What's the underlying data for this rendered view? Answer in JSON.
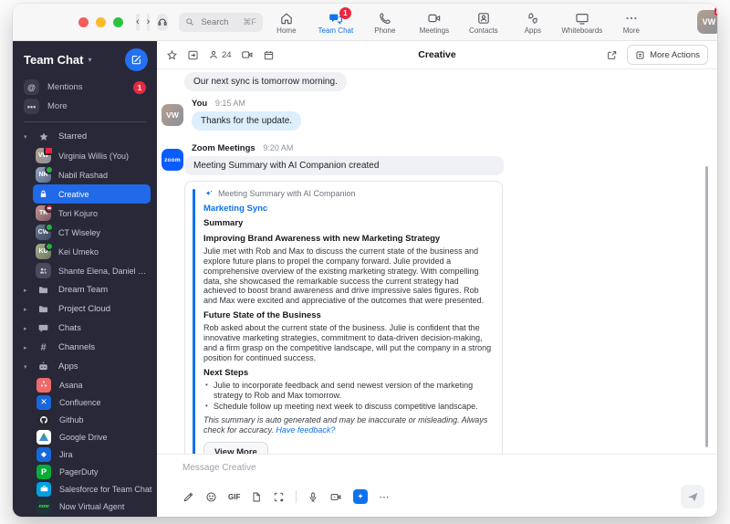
{
  "colors": {
    "accent_blue": "#0E72ED",
    "selection_blue": "#2069E8",
    "badge_red": "#E8283F",
    "presence_green": "#23B33A",
    "sidebar_bg": "#282839"
  },
  "titlebar": {
    "search": {
      "placeholder": "Search",
      "shortcut": "⌘F"
    },
    "nav": [
      {
        "label": "Home",
        "icon": "home-icon"
      },
      {
        "label": "Team Chat",
        "icon": "team-chat-icon",
        "badge": "1",
        "active": true
      },
      {
        "label": "Phone",
        "icon": "phone-icon"
      },
      {
        "label": "Meetings",
        "icon": "meetings-icon"
      },
      {
        "label": "Contacts",
        "icon": "contacts-icon"
      },
      {
        "label": "Apps",
        "icon": "apps-icon"
      },
      {
        "label": "Whiteboards",
        "icon": "whiteboards-icon"
      },
      {
        "label": "More",
        "icon": "ellipsis-icon"
      }
    ],
    "user": {
      "initials": "VW",
      "status": "recording"
    }
  },
  "sidebar": {
    "title": "Team Chat",
    "mentions": {
      "label": "Mentions",
      "badge": "1",
      "icon": "at-icon"
    },
    "more": {
      "label": "More",
      "icon": "ellipsis-icon"
    },
    "starred": {
      "label": "Starred",
      "items": [
        {
          "name": "Virginia Willis (You)",
          "initials": "VW",
          "status": "recording"
        },
        {
          "name": "Nabil Rashad",
          "initials": "NR",
          "status": "online"
        },
        {
          "name": "Creative",
          "type": "locked-channel",
          "selected": true
        },
        {
          "name": "Tori Kojuro",
          "initials": "TK",
          "status": "dnd"
        },
        {
          "name": "CT Wiseley",
          "initials": "CW",
          "status": "online"
        },
        {
          "name": "Kei Umeko",
          "initials": "KU",
          "status": "online"
        },
        {
          "name": "Shante Elena, Daniel Bow...",
          "type": "group"
        }
      ]
    },
    "sections": [
      {
        "label": "Dream Team",
        "icon": "folder-icon"
      },
      {
        "label": "Project Cloud",
        "icon": "folder-icon"
      },
      {
        "label": "Chats",
        "icon": "chat-bubble-icon"
      },
      {
        "label": "Channels",
        "icon": "hash-icon"
      },
      {
        "label": "Apps",
        "icon": "robot-icon",
        "expanded": true
      }
    ],
    "apps": [
      {
        "name": "Asana"
      },
      {
        "name": "Confluence"
      },
      {
        "name": "Github"
      },
      {
        "name": "Google Drive"
      },
      {
        "name": "Jira"
      },
      {
        "name": "PagerDuty"
      },
      {
        "name": "Salesforce for Team Chat"
      },
      {
        "name": "Now Virtual Agent",
        "logo_text": "now"
      }
    ]
  },
  "chat": {
    "title": "Creative",
    "member_count": "24",
    "more_actions_label": "More Actions",
    "messages": {
      "earlier_text": "Our next sync is tomorrow morning.",
      "you": {
        "sender": "You",
        "time": "9:15 AM",
        "text": "Thanks for the update.",
        "initials": "VW"
      },
      "bot": {
        "sender": "Zoom Meetings",
        "time": "9:20 AM",
        "notice": "Meeting Summary with AI Companion created",
        "logo_text": "zoom"
      }
    },
    "summary_card": {
      "header": "Meeting Summary with AI Companion",
      "meeting_title": "Marketing Sync",
      "summary_label": "Summary",
      "section1_heading": "Improving Brand Awareness with new Marketing Strategy",
      "section1_body": "Julie met with Rob and Max to discuss the current state of the business and explore future plans to propel the company forward. Julie provided a comprehensive overview of the existing marketing strategy. With compelling data, she showcased the remarkable success the current strategy had achieved to boost brand awareness and drive impressive sales figures. Rob and Max were excited and appreciative of the outcomes that were presented.",
      "section2_heading": "Future State of the Business",
      "section2_body": "Rob asked about the current state of the business. Julie is confident that the innovative marketing strategies, commitment to data-driven decision-making, and a firm grasp on the competitive landscape, will put the company in a strong position for continued success.",
      "section3_heading": "Next Steps",
      "bullets": [
        "Julie to incorporate feedback and send newest version of the marketing strategy to Rob and Max tomorrow.",
        "Schedule follow up meeting next week to discuss competitive landscape."
      ],
      "disclaimer": "This summary is auto generated and may be inaccurate or misleading. Always check for accuracy.",
      "feedback_link": "Have feedback?",
      "view_more_label": "View More"
    },
    "composer": {
      "placeholder": "Message Creative",
      "gif_label": "GIF"
    }
  }
}
